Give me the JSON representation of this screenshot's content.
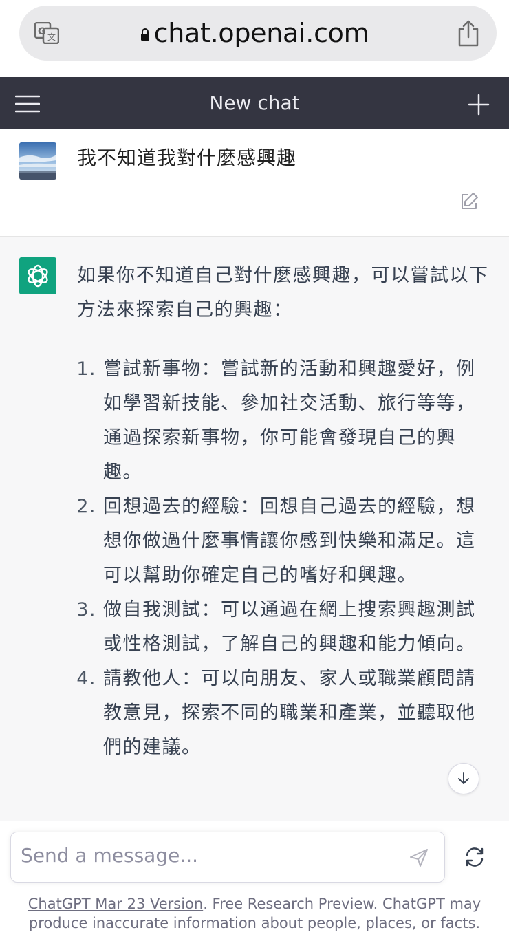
{
  "browser": {
    "url": "chat.openai.com"
  },
  "header": {
    "title": "New chat"
  },
  "user_message": {
    "text": "我不知道我對什麼感興趣"
  },
  "assistant_message": {
    "intro": "如果你不知道自己對什麼感興趣，可以嘗試以下方法來探索自己的興趣：",
    "items": [
      {
        "num": "1.",
        "text": "嘗試新事物：嘗試新的活動和興趣愛好，例如學習新技能、參加社交活動、旅行等等，通過探索新事物，你可能會發現自己的興趣。"
      },
      {
        "num": "2.",
        "text": "回想過去的經驗：回想自己過去的經驗，想想你做過什麼事情讓你感到快樂和滿足。這可以幫助你確定自己的嗜好和興趣。"
      },
      {
        "num": "3.",
        "text": "做自我測試：可以通過在網上搜索興趣測試或性格測試，了解自己的興趣和能力傾向。"
      },
      {
        "num": "4.",
        "text": "請教他人：可以向朋友、家人或職業顧問請教意見，探索不同的職業和產業，並聽取他們的建議。"
      }
    ]
  },
  "composer": {
    "placeholder": "Send a message..."
  },
  "footer": {
    "link_text": "ChatGPT Mar 23 Version",
    "text": ". Free Research Preview. ChatGPT may produce inaccurate information about people, places, or facts."
  },
  "colors": {
    "header_bg": "#343541",
    "assistant_bg": "#f7f7f8",
    "brand_green": "#10a37f"
  },
  "icons": [
    "translate-icon",
    "lock-icon",
    "share-icon",
    "menu-icon",
    "plus-icon",
    "edit-icon",
    "openai-logo-icon",
    "arrow-down-icon",
    "send-icon",
    "regenerate-icon"
  ]
}
